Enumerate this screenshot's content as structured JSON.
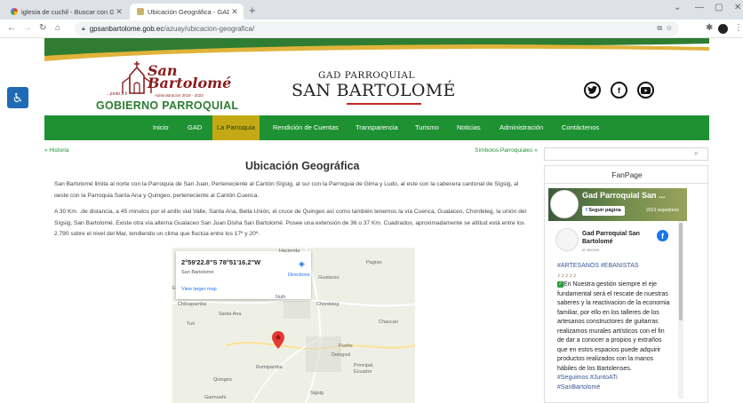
{
  "browser": {
    "tabs": [
      {
        "title": "iglesia de cuchil - Buscar con Goo",
        "active": false
      },
      {
        "title": "Ubicación Geográfica - GAD parro",
        "active": true
      }
    ],
    "new_tab": "+",
    "url_host": "gpsanbartolome.gob.ec",
    "url_path": "/azuay/ubicacion-geografica/",
    "window_controls": [
      "⌄",
      "—",
      "▢",
      "✕"
    ]
  },
  "header": {
    "logo": {
      "san": "San",
      "bartolome": "Bartolomé",
      "slogan": "...junto a ti",
      "admin_period": "Administración 2019 - 2023",
      "gobierno": "GOBIERNO PARROQUIAL"
    },
    "gad_small": "GAD PARROQUIAL",
    "gad_big": "SAN BARTOLOMÉ",
    "social": [
      {
        "icon": "twitter-icon",
        "glyph": "t"
      },
      {
        "icon": "facebook-icon",
        "glyph": "f"
      },
      {
        "icon": "youtube-icon",
        "glyph": "▶"
      }
    ]
  },
  "nav": {
    "items": [
      {
        "label": "Inicio"
      },
      {
        "label": "GAD"
      },
      {
        "label": "La Parroquia",
        "active": true
      },
      {
        "label": "Rendición de Cuentas"
      },
      {
        "label": "Transparencia"
      },
      {
        "label": "Turismo"
      },
      {
        "label": "Noticias"
      },
      {
        "label": "Administración"
      },
      {
        "label": "Contáctenos"
      }
    ]
  },
  "breadcrumbs": {
    "prev": "« Historia",
    "next": "Símbolos Parroquiales »"
  },
  "main": {
    "title": "Ubicación Geográfica",
    "paragraph1": "San Bartolomé limita al norte con la Parroquia de San Juan, Perteneciente al Cantón Sígsig, al sur con la Parroquia de Gima y Ludo, al este con la cabecera cantonal de Sígsig, al oeste con la Parroquia Santa Ana y Quingeo, perteneciente al Cantón Cuenca.",
    "paragraph2": "A 30 Km. .de distancia, a 45 minutos por el anillo vial Valle, Santa Ana, Bella Unión, el cruce de Quingeo así como también tenemos la vía Cuenca, Gualaceo, Chordeleg, la unión del Sígsig, San Bartolomé. Existe otra vía alterna Gualaceo San Juan Disha San Bartolomé. Posee una extensión de 36 o 37 Km. Cuadrados, aproximadamente se altitud está entre los 2.790 sobre el nivel del Mar, tendiendo un clima que fluctúa entre los 17º y 20º."
  },
  "map": {
    "coordinates": "2°59'22.8\"S 78°51'16.2\"W",
    "place": "San Bartolomé",
    "directions": "Directions",
    "view_larger": "View larger map",
    "labels": [
      "Hacienda",
      "Pagran",
      "Gualaceo",
      "Nulti",
      "Chilcapamba",
      "Santa Ana",
      "Chordeleg",
      "Turi",
      "Chaucan",
      "Pusho",
      "Delegsol",
      "Principal, Ecuador",
      "Rumipamba",
      "Quingeo",
      "Sigsig",
      "Garmuahi",
      "E"
    ]
  },
  "sidebar": {
    "fanpage_title": "FanPage",
    "page_name": "Gad Parroquial San ...",
    "follow_button": "Seguir página",
    "followers": "2013 seguidores",
    "post_author": "Gad Parroquial San Bartolomé",
    "post_time": "el viernes",
    "post_tags": "#ARTESANOS #EBANISTAS",
    "post_body": "En Nuestra gestión siempre el eje fundamental será el rescate de nuestras saberes y la reactivacion de la economia familiar, por ello en los talleres de los artesanos constructores de guitarras realizamos murales artísticos con el fin de dar a conocer a propios y extraños que en estos espacios puede adquirir productos realizados con la manos hábiles de los Bartolenses.",
    "post_hashtags": "#Seguimos #JuntoATi",
    "post_hashtags2": "#SanBartolomé"
  },
  "colors": {
    "nav_green": "#1e9233",
    "nav_active": "#c5a914",
    "brand_red": "#8a1c1c",
    "a11y_blue": "#1f6ab5"
  }
}
